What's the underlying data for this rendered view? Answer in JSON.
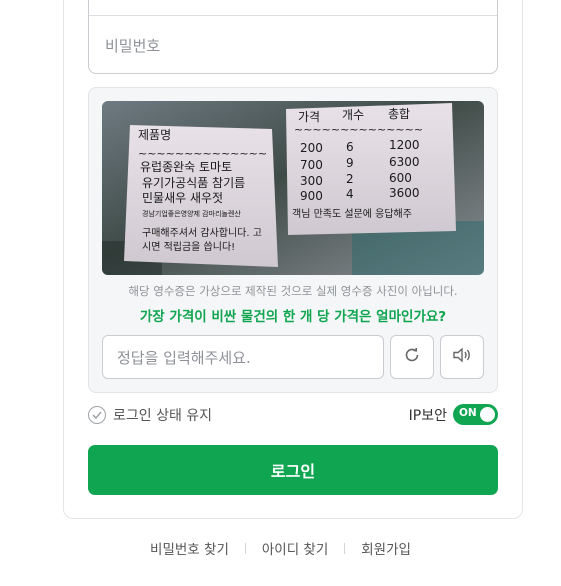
{
  "login": {
    "password_placeholder": "비밀번호",
    "keep_login": "로그인 상태 유지",
    "ip_security": "IP보안",
    "ip_toggle": "ON",
    "login_button": "로그인"
  },
  "captcha": {
    "receipt_left": {
      "header": "제품명",
      "wave": "~~~~~~~~~~~~~~",
      "items": [
        "유럽종완숙 토마토",
        "유기가공식품 참기름",
        "민물새우 새우젓"
      ],
      "small_line": "경남기업좋은영양제 감마리놀렌산",
      "thanks_1": "구매해주셔서 감사합니다. 고",
      "thanks_2": "시면 적립금을 씁니다!"
    },
    "receipt_right": {
      "headers": [
        "가격",
        "개수",
        "총합"
      ],
      "wave": "~~~~~~~~~~~~~~",
      "rows": [
        [
          "200",
          "6",
          "1200"
        ],
        [
          "700",
          "9",
          "6300"
        ],
        [
          "300",
          "2",
          "600"
        ],
        [
          "900",
          "4",
          "3600"
        ]
      ],
      "footer": "객님 만족도 설문에 응답해주"
    },
    "notice": "해당 영수증은 가상으로 제작된 것으로 실제 영수증 사진이 아닙니다.",
    "question": "가장 가격이 비싼 물건의 한 개 당 가격은 얼마인가요?",
    "answer_placeholder": "정답을 입력해주세요.",
    "refresh_icon": "refresh-icon",
    "audio_icon": "speaker-icon"
  },
  "footer_links": [
    "비밀번호 찾기",
    "아이디 찾기",
    "회원가입"
  ],
  "colors": {
    "accent": "#10a550"
  }
}
